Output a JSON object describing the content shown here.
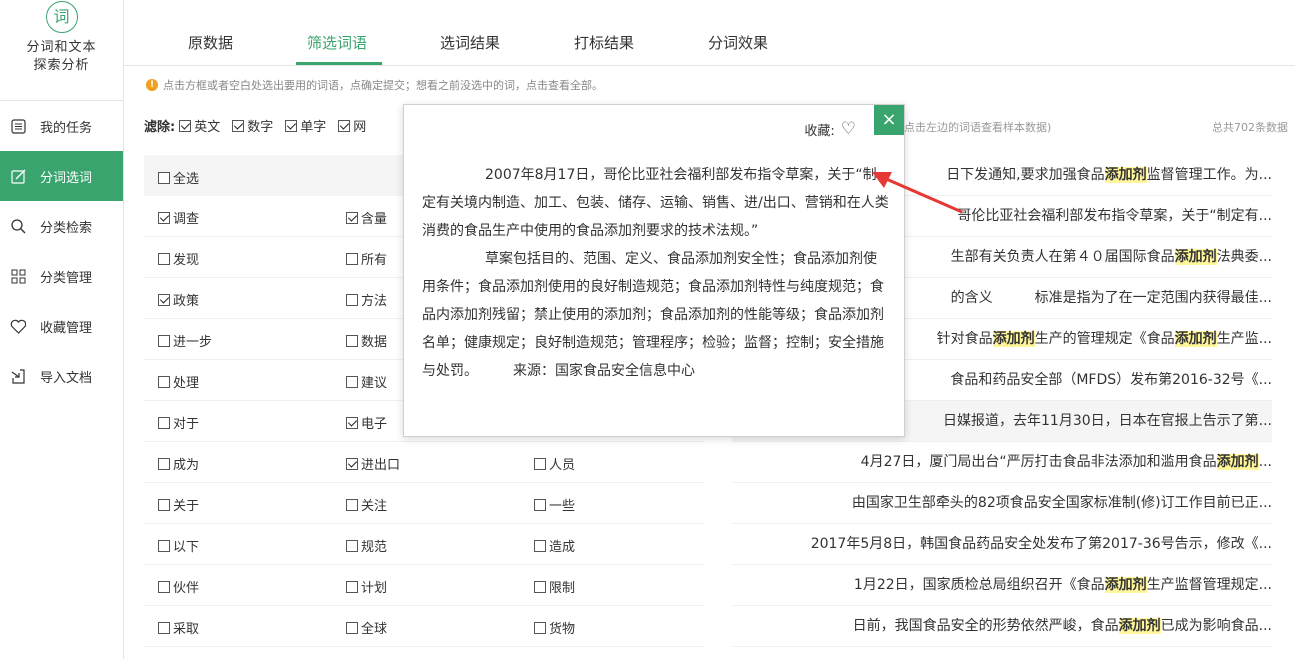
{
  "brand": {
    "logo_char": "词",
    "title_line1": "分词和文本",
    "title_line2": "探索分析"
  },
  "sidebar": {
    "items": [
      {
        "label": "我的任务",
        "icon": "list-icon"
      },
      {
        "label": "分词选词",
        "icon": "edit-icon",
        "active": true
      },
      {
        "label": "分类检索",
        "icon": "search-icon"
      },
      {
        "label": "分类管理",
        "icon": "grid-icon"
      },
      {
        "label": "收藏管理",
        "icon": "heart-icon"
      },
      {
        "label": "导入文档",
        "icon": "import-icon"
      }
    ]
  },
  "tabs": [
    "原数据",
    "筛选词语",
    "选词结果",
    "打标结果",
    "分词效果"
  ],
  "active_tab": "筛选词语",
  "hint": "点击方框或者空白处选出要用的词语，点确定提交；想看之前没选中的词，点击查看全部。",
  "filter": {
    "label": "滤除:",
    "options": [
      {
        "label": "英文",
        "checked": true
      },
      {
        "label": "数字",
        "checked": true
      },
      {
        "label": "单字",
        "checked": true
      },
      {
        "label": "网",
        "checked": true
      }
    ]
  },
  "summary_mid": "点击左边的词语查看样本数据)",
  "summary_right": "总共702条数据",
  "select_all": "全选",
  "word_rows": [
    [
      {
        "w": "调查",
        "c": true
      },
      {
        "w": "含量",
        "c": true
      },
      null
    ],
    [
      {
        "w": "发现",
        "c": false
      },
      {
        "w": "所有",
        "c": false
      },
      null
    ],
    [
      {
        "w": "政策",
        "c": true
      },
      {
        "w": "方法",
        "c": false
      },
      null
    ],
    [
      {
        "w": "进一步",
        "c": false
      },
      {
        "w": "数据",
        "c": false
      },
      null
    ],
    [
      {
        "w": "处理",
        "c": false
      },
      {
        "w": "建议",
        "c": false
      },
      null
    ],
    [
      {
        "w": "对于",
        "c": false
      },
      {
        "w": "电子",
        "c": true
      },
      null
    ],
    [
      {
        "w": "成为",
        "c": false
      },
      {
        "w": "进出口",
        "c": true
      },
      {
        "w": "人员",
        "c": false
      }
    ],
    [
      {
        "w": "关于",
        "c": false
      },
      {
        "w": "关注",
        "c": false
      },
      {
        "w": "一些",
        "c": false
      }
    ],
    [
      {
        "w": "以下",
        "c": false
      },
      {
        "w": "规范",
        "c": false
      },
      {
        "w": "造成",
        "c": false
      }
    ],
    [
      {
        "w": "伙伴",
        "c": false
      },
      {
        "w": "计划",
        "c": false
      },
      {
        "w": "限制",
        "c": false
      }
    ],
    [
      {
        "w": "采取",
        "c": false
      },
      {
        "w": "全球",
        "c": false
      },
      {
        "w": "货物",
        "c": false
      }
    ]
  ],
  "sentences": [
    [
      "日下发通知,要求加强食品",
      "添加剂",
      "监督管理工作。为..."
    ],
    [
      "哥伦比亚社会福利部发布指令草案，关于“制定有..."
    ],
    [
      "生部有关负责人在第４０届国际食品",
      "添加剂",
      "法典委..."
    ],
    [
      "的含义　　　标准是指为了在一定范围内获得最佳..."
    ],
    [
      "针对食品",
      "添加剂",
      "生产的管理规定《食品",
      "添加剂",
      "生产监..."
    ],
    [
      "食品和药品安全部（MFDS）发布第2016-32号《..."
    ],
    [
      "日媒报道，去年11月30日，日本在官报上告示了第..."
    ],
    [
      "4月27日，厦门局出台“严厉打击食品非法添加和滥用食品",
      "添加剂",
      "..."
    ],
    [
      "由国家卫生部牵头的82项食品安全国家标准制(修)订工作目前已正..."
    ],
    [
      "2017年5月8日，韩国食品药品安全处发布了第2017-36号告示，修改《..."
    ],
    [
      "1月22日，国家质检总局组织召开《食品",
      "添加剂",
      "生产监督管理规定..."
    ],
    [
      "日前，我国食品安全的形势依然严峻，食品",
      "添加剂",
      "已成为影响食品..."
    ]
  ],
  "popup": {
    "fav_label": "收藏:",
    "close": "×",
    "para1": "2007年8月17日，哥伦比亚社会福利部发布指令草案，关于“制定有关境内制造、加工、包装、储存、运输、销售、进/出口、营销和在人类消费的食品生产中使用的食品添加剂要求的技术法规。”",
    "para2": "草案包括目的、范围、定义、食品添加剂安全性；食品添加剂使用条件；食品添加剂使用的良好制造规范；食品添加剂特性与纯度规范；食品内添加剂残留；禁止使用的添加剂；食品添加剂的性能等级；食品添加剂名单；健康规定；良好制造规范；管理程序；检验；监督；控制；安全措施与处罚。　　　来源：国家食品安全信息中心"
  },
  "colors": {
    "accent": "#3aa46e",
    "highlight": "#fff59a",
    "arrow": "#e53935"
  }
}
